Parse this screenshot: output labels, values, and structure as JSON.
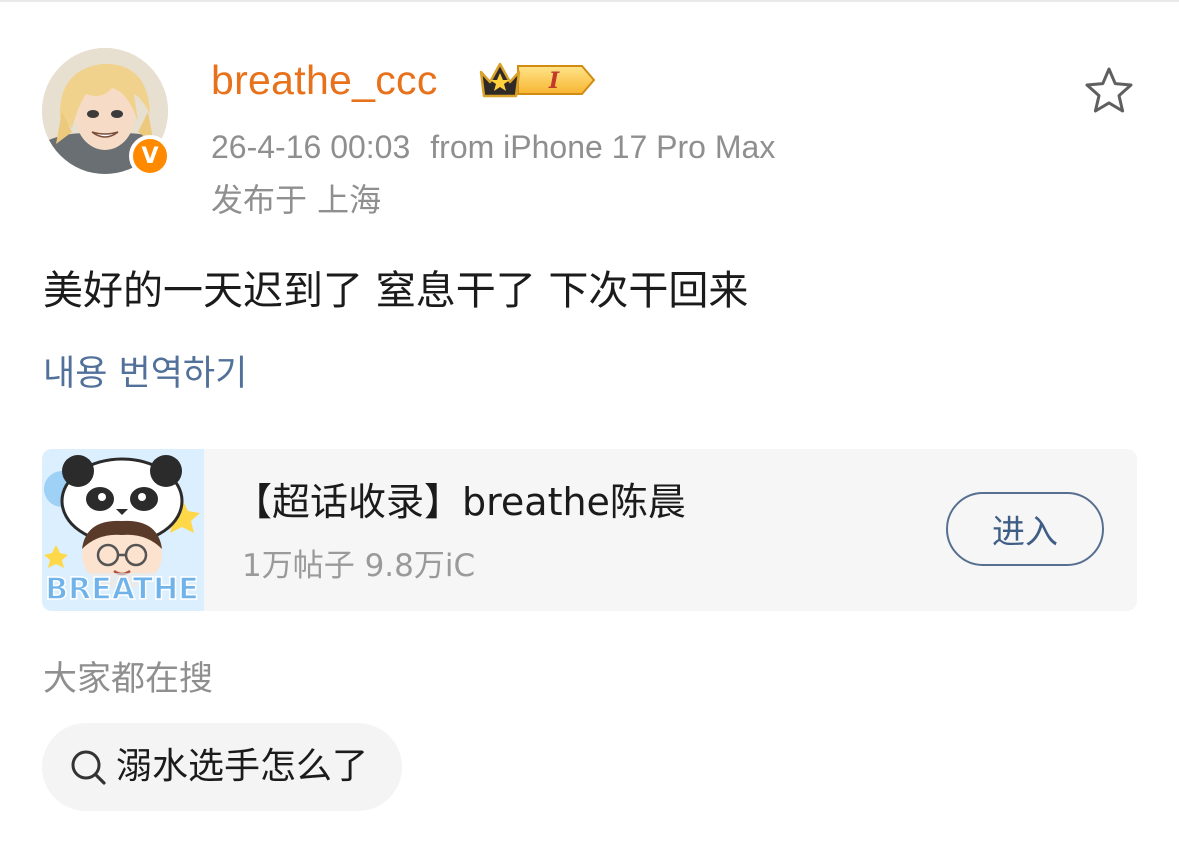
{
  "post": {
    "author": {
      "username": "breathe_ccc",
      "avatar": "avatar",
      "verified_icon": "verified-v-icon",
      "verified_letter": "V",
      "vip_badge_icon": "crown-vip-badge-icon",
      "vip_level": "I"
    },
    "date": "26-4-16 00:03",
    "source": "from iPhone 17 Pro Max",
    "location": "发布于 上海",
    "text": "美好的一天迟到了 窒息干了 下次干回来",
    "translate_label": "내용 번역하기",
    "favorite_icon": "star-outline-icon"
  },
  "topic_card": {
    "thumbnail_icon": "panda-hat-character-thumbnail",
    "thumbnail_text": "BREATHE",
    "title": "【超话收录】breathe陈晨",
    "stats": "1万帖子 9.8万iC",
    "enter_label": "进入"
  },
  "trending": {
    "heading": "大家都在搜",
    "search_icon": "search-icon",
    "items": [
      {
        "label": "溺水选手怎么了"
      }
    ]
  },
  "colors": {
    "username": "#e8721c",
    "verified": "#ff8a00",
    "link": "#51709a",
    "button_border": "#566f90",
    "muted_text": "#8f8f8f",
    "card_bg": "#f6f6f6"
  }
}
